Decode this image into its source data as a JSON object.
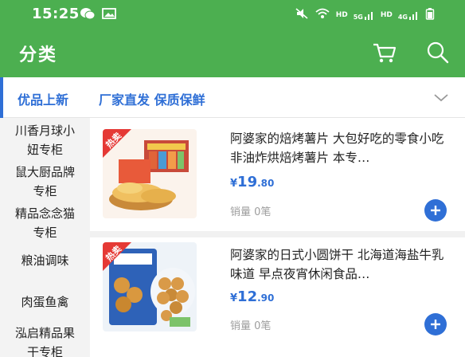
{
  "status_bar": {
    "time": "15:25",
    "right_labels": [
      "HD",
      "HD"
    ],
    "signal_labels": [
      "5G",
      "4G"
    ]
  },
  "app_bar": {
    "title": "分类",
    "icons": [
      "cart-icon",
      "search-icon"
    ]
  },
  "category_tabs": {
    "primary": "优品上新",
    "secondary": "厂家直发 保质保鲜",
    "expand_icon": "chevron-down-icon"
  },
  "sidebar": {
    "items": [
      {
        "lines": [
          "川香月球小",
          "妞专柜"
        ]
      },
      {
        "lines": [
          "鼠大厨品牌",
          "专柜"
        ]
      },
      {
        "lines": [
          "精品念念猫",
          "专柜"
        ]
      },
      {
        "lines": [
          "粮油调味"
        ]
      },
      {
        "lines": [
          "肉蛋鱼禽"
        ]
      },
      {
        "lines": [
          "泓启精品果",
          "干专柜"
        ]
      }
    ]
  },
  "products": [
    {
      "badge": "热卖",
      "title": "阿婆家的焙烤薯片 大包好吃的零食小吃 非油炸烘焙烤薯片 本专…",
      "price_currency": "¥",
      "price_int": "19",
      "price_dec": ".80",
      "sales": "销量 0笔",
      "add_icon": "plus-icon"
    },
    {
      "badge": "热卖",
      "title": "阿婆家的日式小圆饼干 北海道海盐牛乳味道 早点夜宵休闲食品…",
      "price_currency": "¥",
      "price_int": "12",
      "price_dec": ".90",
      "sales": "销量 0笔",
      "add_icon": "plus-icon"
    }
  ],
  "colors": {
    "brand_green": "#4caf50",
    "accent_blue": "#2f6fd6",
    "hot_badge_red": "#e53935"
  }
}
